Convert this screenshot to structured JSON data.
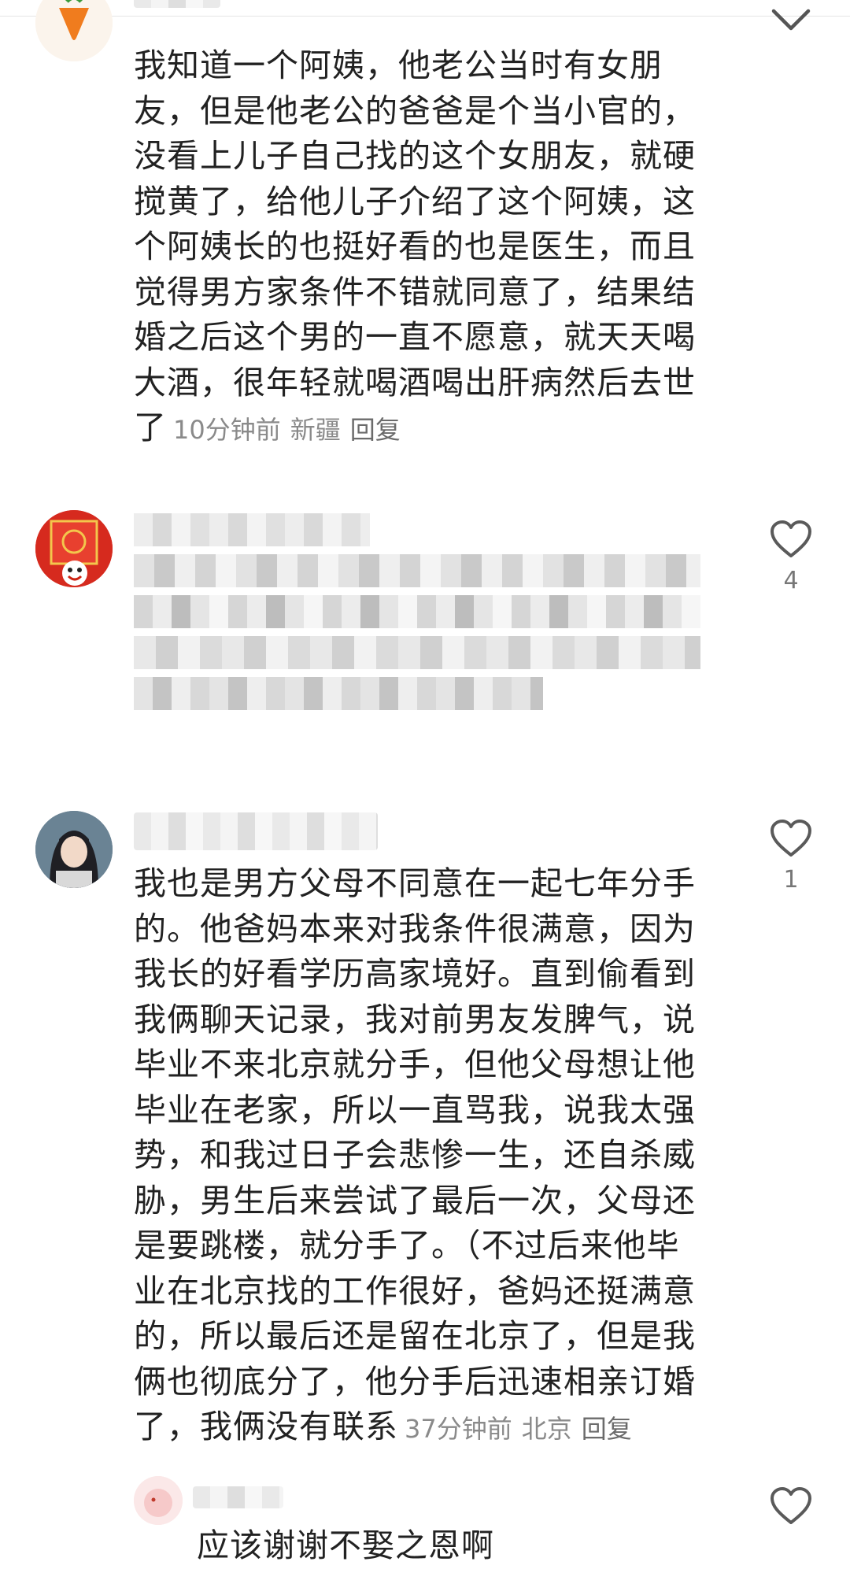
{
  "comments": [
    {
      "text": "我知道一个阿姨，他老公当时有女朋友，但是他老公的爸爸是个当小官的，没看上儿子自己找的这个女朋友，就硬搅黄了，给他儿子介绍了这个阿姨，这个阿姨长的也挺好看的也是医生，而且觉得男方家条件不错就同意了，结果结婚之后这个男的一直不愿意，就天天喝大酒，很年轻就喝酒喝出肝病然后去世了",
      "time": "10分钟前",
      "location": "新疆",
      "reply_label": "回复"
    },
    {
      "like_count": "4"
    },
    {
      "text": "我也是男方父母不同意在一起七年分手的。他爸妈本来对我条件很满意，因为我长的好看学历高家境好。直到偷看到我俩聊天记录，我对前男友发脾气，说毕业不来北京就分手，但他父母想让他毕业在老家，所以一直骂我，说我太强势，和我过日子会悲惨一生，还自杀威胁，男生后来尝试了最后一次，父母还是要跳楼，就分手了。（不过后来他毕业在北京找的工作很好，爸妈还挺满意的，所以最后还是留在北京了，但是我俩也彻底分了，他分手后迅速相亲订婚了，我俩没有联系",
      "time": "37分钟前",
      "location": "北京",
      "reply_label": "回复",
      "like_count": "1"
    },
    {
      "text": "应该谢谢不娶之恩啊"
    }
  ],
  "icons": {
    "like": "heart-outline-icon",
    "collapse": "chevron-down-icon"
  },
  "colors": {
    "meta_gray": "#8a8a8a",
    "text": "#222222",
    "like_stroke": "#5a5a5a"
  }
}
